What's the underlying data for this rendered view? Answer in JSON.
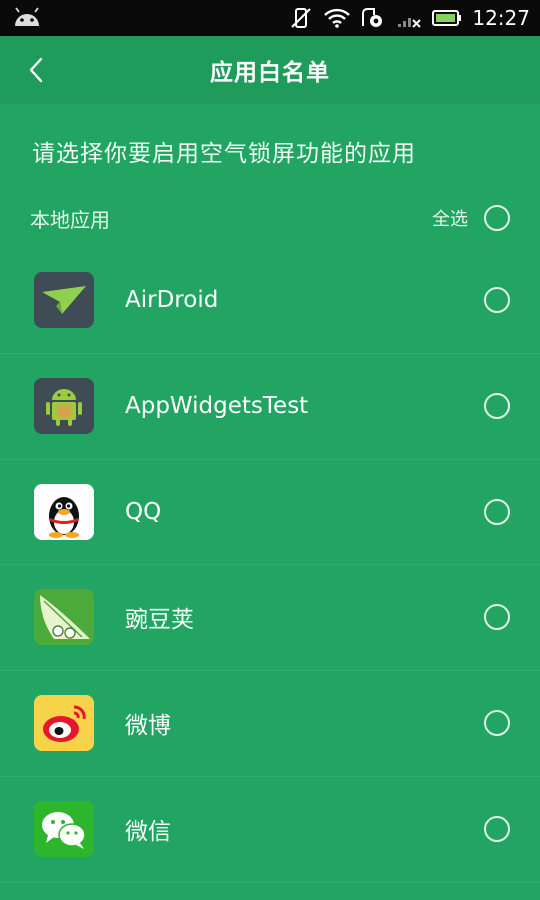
{
  "status_bar": {
    "time": "12:27"
  },
  "toolbar": {
    "title": "应用白名单"
  },
  "subtitle": "请选择你要启用空气锁屏功能的应用",
  "section": {
    "label": "本地应用",
    "select_all_label": "全选"
  },
  "apps": [
    {
      "name": "AirDroid",
      "icon": "airdroid-icon",
      "selected": false
    },
    {
      "name": "AppWidgetsTest",
      "icon": "android-icon",
      "selected": false
    },
    {
      "name": "QQ",
      "icon": "qq-penguin-icon",
      "selected": false
    },
    {
      "name": "豌豆荚",
      "icon": "wandoujia-icon",
      "selected": false
    },
    {
      "name": "微博",
      "icon": "weibo-icon",
      "selected": false
    },
    {
      "name": "微信",
      "icon": "wechat-icon",
      "selected": false
    }
  ],
  "colors": {
    "background": "#22a562",
    "toolbar": "#1f9b5b",
    "status_bar": "#0a0a0a"
  }
}
